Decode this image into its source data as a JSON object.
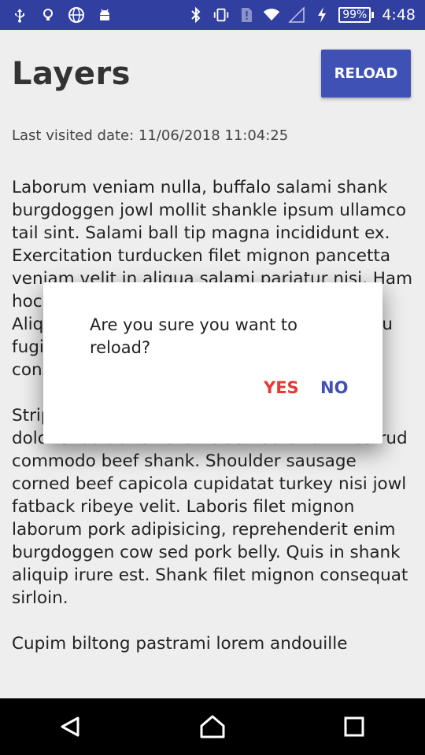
{
  "status_bar": {
    "left_icons": [
      "usb-icon",
      "lightbulb-icon",
      "globe-icon",
      "android-icon"
    ],
    "right_icons": [
      "bluetooth-icon",
      "vibrate-icon",
      "sim-alert-icon",
      "wifi-icon",
      "cell-signal-icon",
      "charging-icon"
    ],
    "battery": "99%",
    "time": "4:48"
  },
  "header": {
    "title": "Layers",
    "reload_label": "RELOAD",
    "accent": "#3f51b5"
  },
  "visited_label": "Last visited date: 11/06/2018 11:04:25",
  "paragraphs": [
    "Laborum veniam nulla, buffalo salami shank burgdoggen jowl mollit shankle ipsum ullamco tail sint.  Salami ball tip magna incididunt ex.  Exercitation turducken filet mignon pancetta veniam velit in aliqua salami pariatur nisi.  Ham hock laboris in pariatur jerky alcatra elit.  Aliquip cupim veniam ribs ball tip venison eu fugiat brisket consectetur prosciutto ea consequat ute.",
    "Strip steak jowl ham hock kielbasa ut velit dolor shoulder chicken eiusmod cillum nostrud commodo beef shank.  Shoulder sausage corned beef capicola cupidatat turkey nisi jowl fatback ribeye velit.  Laboris filet mignon laborum pork adipisicing, reprehenderit enim burgdoggen cow sed pork belly.  Quis in shank aliquip irure est.  Shank filet mignon consequat sirloin.",
    "Cupim biltong pastrami lorem andouille"
  ],
  "dialog": {
    "message": "Are you sure you want to reload?",
    "yes_label": "YES",
    "no_label": "NO",
    "yes_color": "#e53935",
    "no_color": "#3f51b5"
  },
  "nav_bar": {
    "back": "back-icon",
    "home": "home-icon",
    "recents": "recents-icon"
  }
}
